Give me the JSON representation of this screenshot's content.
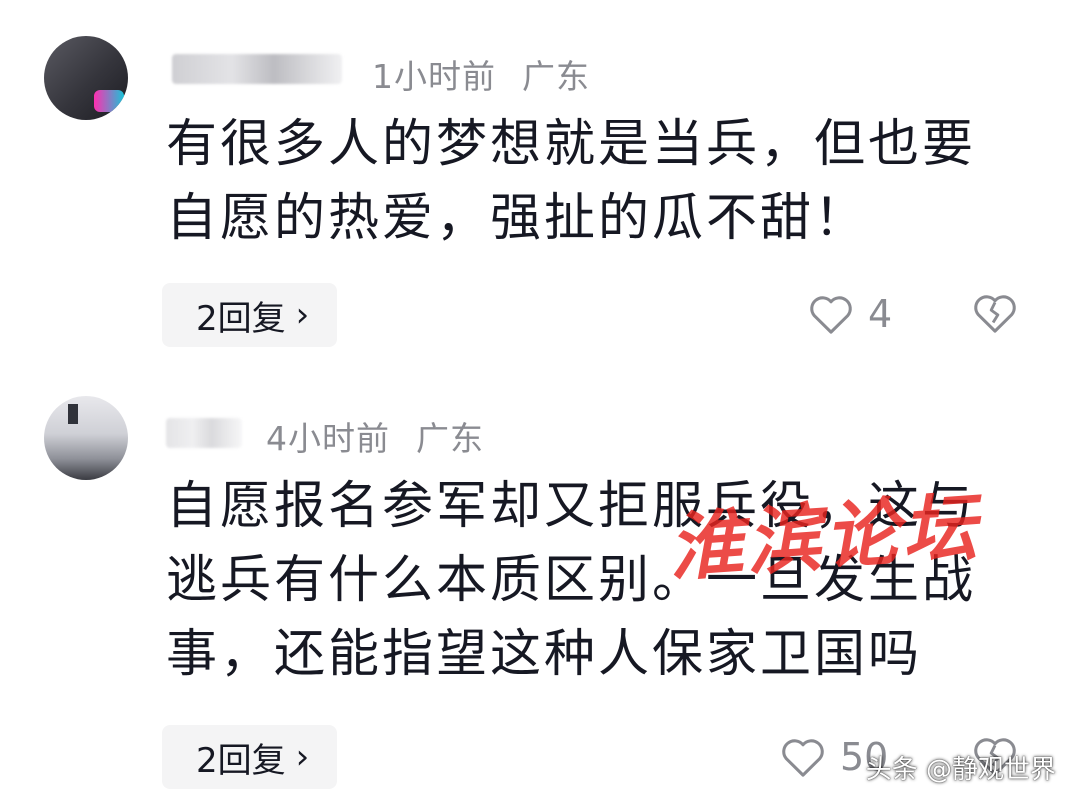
{
  "comments": [
    {
      "time": "1小时前",
      "location": "广东",
      "text": "有很多人的梦想就是当兵，但也要\n自愿的热爱，强扯的瓜不甜！",
      "reply_label": "2回复",
      "like_count": "4"
    },
    {
      "time": "4小时前",
      "location": "广东",
      "text": "自愿报名参军却又拒服兵役，这与\n逃兵有什么本质区别。一旦发生战\n事，还能指望这种人保家卫国吗",
      "reply_label": "2回复",
      "like_count": "50"
    }
  ],
  "icons": {
    "reply_chevron": "chevron-right-icon",
    "like": "heart-icon",
    "dislike": "broken-heart-icon"
  },
  "watermark": {
    "text": "淮滨论坛",
    "color": "#e8231e"
  },
  "attribution": "头条 @静观世界"
}
